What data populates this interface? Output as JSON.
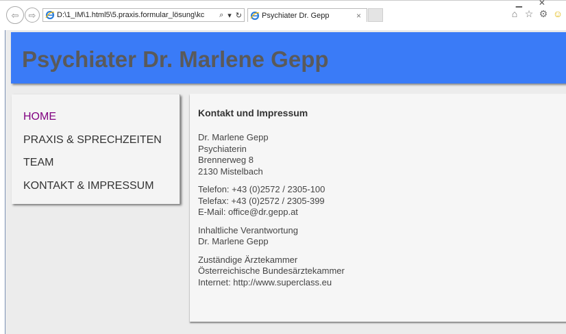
{
  "browser": {
    "address": "D:\\1_IM\\1.html5\\5.praxis.formular_lösung\\kc",
    "tab_title": "Psychiater Dr. Gepp",
    "tab_close": "×",
    "search_glyph": "⌕",
    "dropdown_glyph": "▾",
    "refresh_glyph": "↻",
    "back_glyph": "⇦",
    "forward_glyph": "⇨",
    "toolbar_icons": [
      "home-icon",
      "favorites-star-icon",
      "settings-gear-icon",
      "smiley-feedback-icon"
    ]
  },
  "site": {
    "title": "Psychiater Dr. Marlene Gepp",
    "header_color": "#3a7bf7",
    "active_link_color": "#800080"
  },
  "nav": {
    "items": [
      {
        "label": "HOME",
        "active": true
      },
      {
        "label": "PRAXIS & SPRECHZEITEN",
        "active": false
      },
      {
        "label": "TEAM",
        "active": false
      },
      {
        "label": "KONTAKT & IMPRESSUM",
        "active": false
      }
    ]
  },
  "content": {
    "heading": "Kontakt und Impressum",
    "address": {
      "name": "Dr. Marlene Gepp",
      "profession": "Psychiaterin",
      "street": "Brennerweg 8",
      "city": "2130 Mistelbach"
    },
    "contact": {
      "phone": "Telefon: +43 (0)2572 / 2305-100",
      "fax": "Telefax: +43 (0)2572 / 2305-399",
      "email": "E-Mail: office@dr.gepp.at"
    },
    "responsibility": {
      "label": "Inhaltliche Verantwortung",
      "name": "Dr. Marlene Gepp"
    },
    "chamber": {
      "label": "Zuständige Ärztekammer",
      "name": "Österreichische Bundesärztekammer",
      "internet": "Internet: http://www.superclass.eu"
    }
  }
}
